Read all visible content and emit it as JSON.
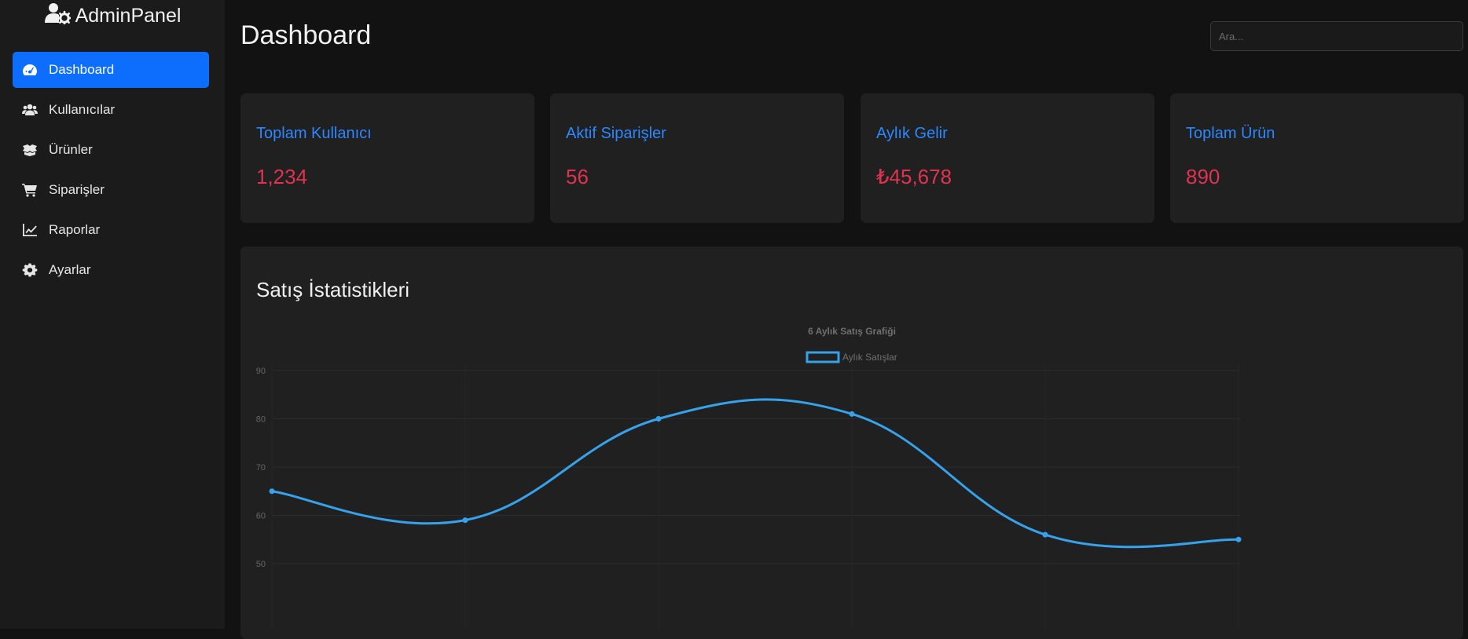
{
  "brand": {
    "name": "AdminPanel",
    "icon": "user-gear-icon"
  },
  "sidebar": {
    "items": [
      {
        "label": "Dashboard",
        "icon": "gauge-icon",
        "active": true
      },
      {
        "label": "Kullanıcılar",
        "icon": "users-icon",
        "active": false
      },
      {
        "label": "Ürünler",
        "icon": "box-icon",
        "active": false
      },
      {
        "label": "Siparişler",
        "icon": "cart-icon",
        "active": false
      },
      {
        "label": "Raporlar",
        "icon": "line-chart-icon",
        "active": false
      },
      {
        "label": "Ayarlar",
        "icon": "gear-icon",
        "active": false
      }
    ]
  },
  "header": {
    "title": "Dashboard",
    "search": {
      "placeholder": "Ara...",
      "value": ""
    }
  },
  "stats": [
    {
      "label": "Toplam Kullanıcı",
      "value": "1,234"
    },
    {
      "label": "Aktif Siparişler",
      "value": "56"
    },
    {
      "label": "Aylık Gelir",
      "value": "₺45,678"
    },
    {
      "label": "Toplam Ürün",
      "value": "890"
    }
  ],
  "sales": {
    "section_title": "Satış İstatistikleri"
  },
  "colors": {
    "accent": "#0d6efd",
    "stat_label": "#2d87ff",
    "stat_value": "#e0334f",
    "line": "#36a2eb"
  },
  "chart_data": {
    "type": "line",
    "title": "6 Aylık Satış Grafiği",
    "legend_position": "top",
    "grid": true,
    "series": [
      {
        "name": "Aylık Satışlar",
        "values": [
          65,
          59,
          80,
          81,
          56,
          55
        ]
      }
    ],
    "y_ticks": [
      50,
      60,
      70,
      80,
      90
    ],
    "ylim": [
      45,
      90
    ]
  }
}
